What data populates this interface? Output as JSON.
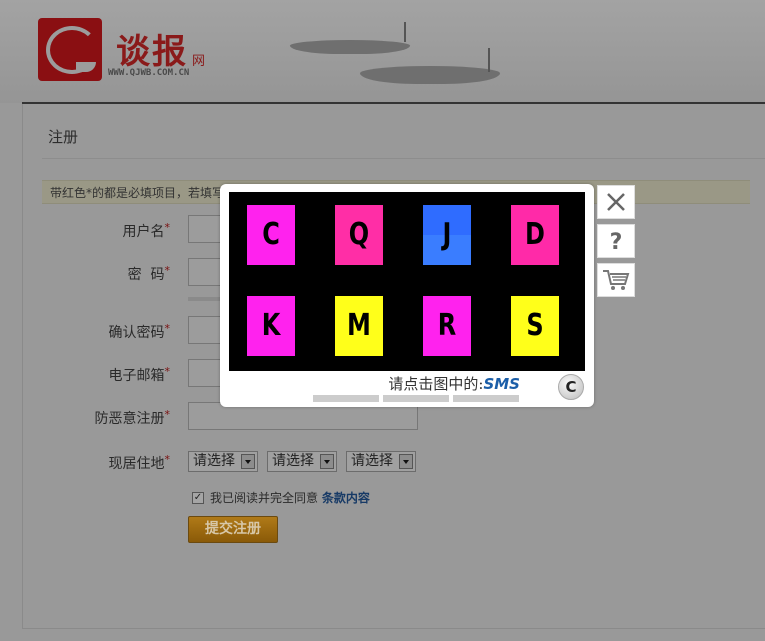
{
  "site": {
    "logo_name": "谈报",
    "logo_suffix": "网",
    "logo_url": "WWW.QJWB.COM.CN"
  },
  "form": {
    "title": "注册",
    "notice": "带红色*的都是必填项目，若填写",
    "required_mark": "*",
    "fields": [
      {
        "label": "用户名",
        "value": ""
      },
      {
        "label": "密  码",
        "value": ""
      },
      {
        "label": "确认密码",
        "value": ""
      },
      {
        "label": "电子邮箱",
        "value": ""
      },
      {
        "label": "防恶意注册",
        "value": ""
      }
    ],
    "residence": {
      "label": "现居住地",
      "selects": [
        "请选择",
        "请选择",
        "请选择"
      ]
    },
    "agree_checked": true,
    "agree_text": "我已阅读并完全同意",
    "agree_link": "条款内容",
    "submit_label": "提交注册"
  },
  "captcha": {
    "tiles": [
      {
        "letter": "C",
        "color": "#ff22ee"
      },
      {
        "letter": "Q",
        "color": "#ff2ea6"
      },
      {
        "letter": "J",
        "color": "#2f6cff"
      },
      {
        "letter": "D",
        "color": "#ff2aa8"
      },
      {
        "letter": "K",
        "color": "#ff22ee"
      },
      {
        "letter": "M",
        "color": "#ffff1a"
      },
      {
        "letter": "R",
        "color": "#ff22ee"
      },
      {
        "letter": "S",
        "color": "#ffff1a"
      }
    ],
    "prompt": "请点击图中的:",
    "target": "SMS",
    "progress_segments": 3,
    "icons": [
      "close-icon",
      "help-icon",
      "cart-icon",
      "refresh-icon"
    ]
  }
}
